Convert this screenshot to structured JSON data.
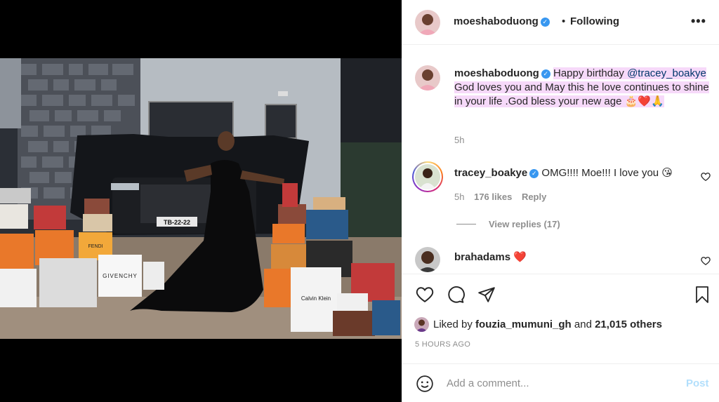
{
  "post": {
    "author": "moeshaboduong",
    "follow_status": "Following",
    "separator": "•",
    "more_label": "•••"
  },
  "caption": {
    "author": "moeshaboduong",
    "text_before": "Happy birthday",
    "mention": "@tracey_boakye",
    "text_after": "God loves you and May this he love continues to shine in your life .God bless your new age 🎂❤️🙏",
    "time": "5h"
  },
  "comments": [
    {
      "author": "tracey_boakye",
      "text": "OMG!!!! Moe!!! I love you 😘",
      "time": "5h",
      "likes": "176 likes",
      "reply_label": "Reply",
      "view_replies": "View replies (17)"
    },
    {
      "author": "brahadams",
      "text": "❤️"
    }
  ],
  "likes": {
    "prefix": "Liked by",
    "user": "fouzia_mumuni_gh",
    "conj": "and",
    "others": "21,015 others"
  },
  "timestamp": "5 HOURS AGO",
  "add_comment": {
    "placeholder": "Add a comment...",
    "post_label": "Post"
  },
  "photo_text": {
    "plate": "TB-22-22",
    "givenchy": "GIVENCHY",
    "fendi": "FENDI",
    "calvin": "Calvin Klein"
  },
  "colors": {
    "verified": "#3897f0",
    "highlight": "#f6d9f9",
    "post_disabled": "#b2dffc"
  }
}
